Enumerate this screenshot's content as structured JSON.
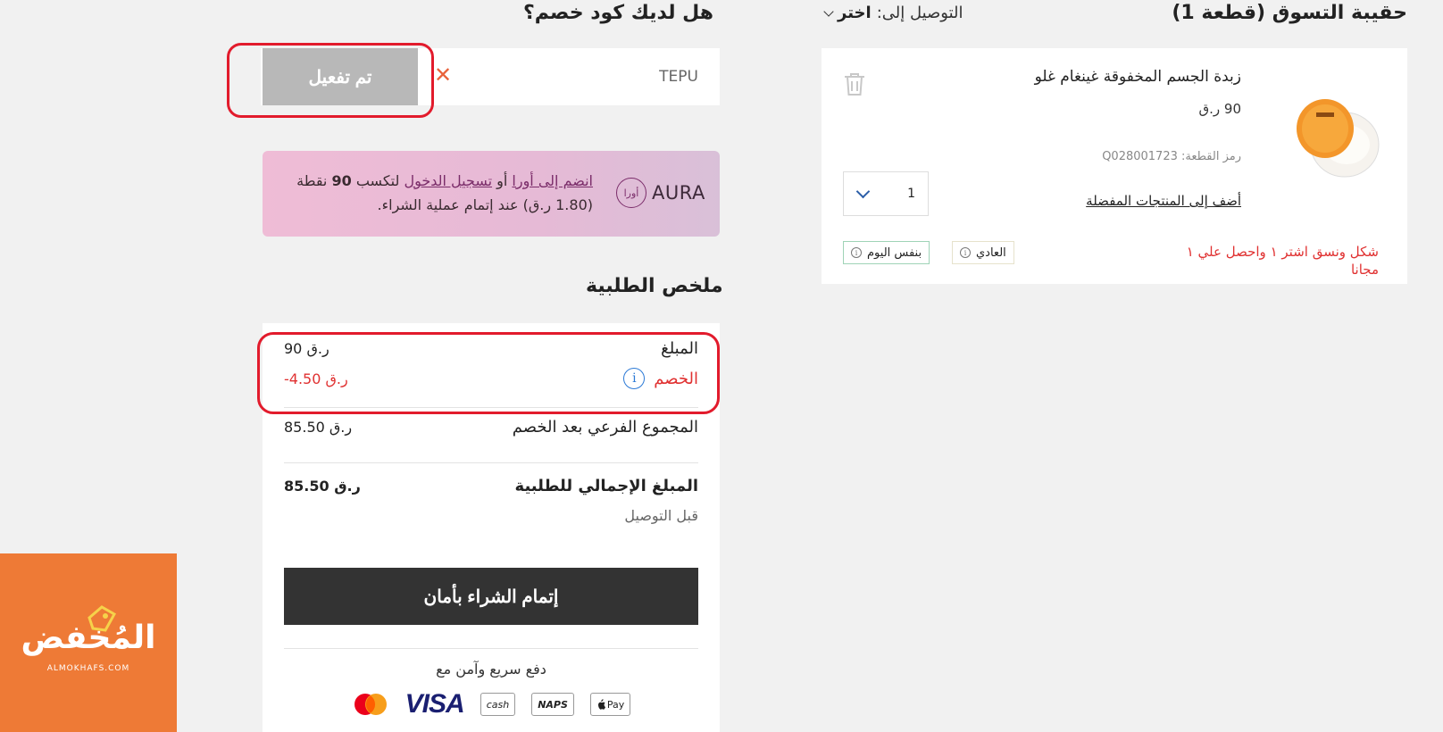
{
  "cart": {
    "title": "حقيبة التسوق (قطعة 1)",
    "delivery_label": "التوصيل إلى:",
    "delivery_value": "اختر",
    "item": {
      "name": "زبدة الجسم المخفوقة غينغام غلو",
      "price": "90 ر.ق",
      "code": "رمز القطعة: Q028001723",
      "favorites_link": "أضف إلى المنتجات المفضلة",
      "quantity": "1",
      "promo_text": "شكل ونسق اشتر ١ واحصل علي ١ مجانا",
      "tag_normal": "العادي",
      "tag_same_day": "بنفس اليوم"
    }
  },
  "coupon": {
    "title": "هل لديك كود خصم؟",
    "input_value": "TEPU",
    "clear_glyph": "✕",
    "button_label": "تم تفعيل"
  },
  "aura": {
    "brand": "AURA",
    "logo_ar": "أورا",
    "join_link": "انضم إلى أورا",
    "or": "أو",
    "login_link": "تسجيل الدخول",
    "earn_prefix": "لتكسب",
    "points": "90",
    "points_suffix": "نقطة",
    "rest": "(1.80 ر.ق) عند إتمام عملية الشراء."
  },
  "summary": {
    "title": "ملخص الطلبية",
    "amount_label": "المبلغ",
    "amount_value": "90 ر.ق",
    "discount_label": "الخصم",
    "discount_value": "-4.50 ر.ق",
    "subtotal_label": "المجموع الفرعي بعد الخصم",
    "subtotal_value": "85.50 ر.ق",
    "total_label": "المبلغ الإجمالي للطلبية",
    "total_value": "85.50 ر.ق",
    "before_delivery": "قبل التوصيل",
    "checkout_label": "إتمام الشراء بأمان",
    "payment_note": "دفع سريع وآمن مع",
    "payment_visa": "VISA",
    "payment_cash": "cash",
    "payment_naps": "NAPS",
    "payment_applepay": "Pay"
  },
  "watermark": {
    "logo_text": "المُخفض",
    "site": "ALMOKHAFS.COM"
  },
  "colors": {
    "highlight": "#e21b2c",
    "discount": "#e03131",
    "checkout_bg": "#333333",
    "watermark_bg": "#ee7a36"
  }
}
